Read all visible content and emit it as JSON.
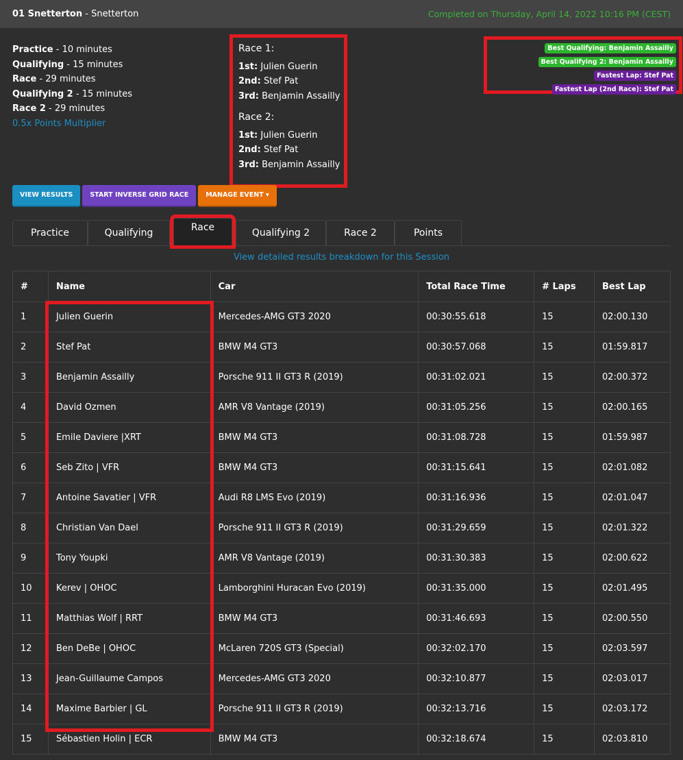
{
  "header": {
    "event": "01 Snetterton",
    "track": "Snetterton",
    "completed": "Completed on Thursday, April 14, 2022 10:16 PM (CEST)"
  },
  "sessions": [
    {
      "name": "Practice",
      "duration": "10 minutes"
    },
    {
      "name": "Qualifying",
      "duration": "15 minutes"
    },
    {
      "name": "Race",
      "duration": "29 minutes"
    },
    {
      "name": "Qualifying 2",
      "duration": "15 minutes"
    },
    {
      "name": "Race 2",
      "duration": "29 minutes"
    }
  ],
  "multiplier": "0.5x Points Multiplier",
  "podium": [
    {
      "title": "Race 1:",
      "places": [
        {
          "pos": "1st:",
          "name": "Julien Guerin"
        },
        {
          "pos": "2nd:",
          "name": "Stef Pat"
        },
        {
          "pos": "3rd:",
          "name": "Benjamin Assailly"
        }
      ]
    },
    {
      "title": "Race 2:",
      "places": [
        {
          "pos": "1st:",
          "name": "Julien Guerin"
        },
        {
          "pos": "2nd:",
          "name": "Stef Pat"
        },
        {
          "pos": "3rd:",
          "name": "Benjamin Assailly"
        }
      ]
    }
  ],
  "badges": [
    "Best Qualifying: Benjamin Assailly",
    "Best Qualifying 2: Benjamin Assailly",
    "Fastest Lap: Stef Pat",
    "Fastest Lap (2nd Race): Stef Pat"
  ],
  "colors": {
    "green": "#2db52d",
    "purple": "#6a1f9a",
    "blue": "#1b8fc2",
    "violet": "#6f42c1",
    "orange": "#e8700a"
  },
  "buttons": {
    "view": "VIEW RESULTS",
    "inverse": "START INVERSE GRID RACE",
    "manage": "MANAGE EVENT"
  },
  "tabs": [
    "Practice",
    "Qualifying",
    "Race",
    "Qualifying 2",
    "Race 2",
    "Points"
  ],
  "active_tab": "Race",
  "detail_link": "View detailed results breakdown for this Session",
  "table": {
    "headers": [
      "#",
      "Name",
      "Car",
      "Total Race Time",
      "# Laps",
      "Best Lap"
    ],
    "rows": [
      [
        "1",
        "Julien Guerin",
        "Mercedes-AMG GT3 2020",
        "00:30:55.618",
        "15",
        "02:00.130"
      ],
      [
        "2",
        "Stef Pat",
        "BMW M4 GT3",
        "00:30:57.068",
        "15",
        "01:59.817"
      ],
      [
        "3",
        "Benjamin Assailly",
        "Porsche 911 II GT3 R (2019)",
        "00:31:02.021",
        "15",
        "02:00.372"
      ],
      [
        "4",
        "David Ozmen",
        "AMR V8 Vantage (2019)",
        "00:31:05.256",
        "15",
        "02:00.165"
      ],
      [
        "5",
        "Emile Daviere |XRT",
        "BMW M4 GT3",
        "00:31:08.728",
        "15",
        "01:59.987"
      ],
      [
        "6",
        "Seb Zito | VFR",
        "BMW M4 GT3",
        "00:31:15.641",
        "15",
        "02:01.082"
      ],
      [
        "7",
        "Antoine Savatier | VFR",
        "Audi R8 LMS Evo (2019)",
        "00:31:16.936",
        "15",
        "02:01.047"
      ],
      [
        "8",
        "Christian Van Dael",
        "Porsche 911 II GT3 R (2019)",
        "00:31:29.659",
        "15",
        "02:01.322"
      ],
      [
        "9",
        "Tony Youpki",
        "AMR V8 Vantage (2019)",
        "00:31:30.383",
        "15",
        "02:00.622"
      ],
      [
        "10",
        "Kerev | OHOC",
        "Lamborghini Huracan Evo (2019)",
        "00:31:35.000",
        "15",
        "02:01.495"
      ],
      [
        "11",
        "Matthias Wolf | RRT",
        "BMW M4 GT3",
        "00:31:46.693",
        "15",
        "02:00.550"
      ],
      [
        "12",
        "Ben DeBe | OHOC",
        "McLaren 720S GT3 (Special)",
        "00:32:02.170",
        "15",
        "02:03.597"
      ],
      [
        "13",
        "Jean-Guillaume Campos",
        "Mercedes-AMG GT3 2020",
        "00:32:10.877",
        "15",
        "02:03.017"
      ],
      [
        "14",
        "Maxime Barbier | GL",
        "Porsche 911 II GT3 R (2019)",
        "00:32:13.716",
        "15",
        "02:03.172"
      ],
      [
        "15",
        "Sébastien Holin | ECR",
        "BMW M4 GT3",
        "00:32:18.674",
        "15",
        "02:03.810"
      ]
    ]
  }
}
